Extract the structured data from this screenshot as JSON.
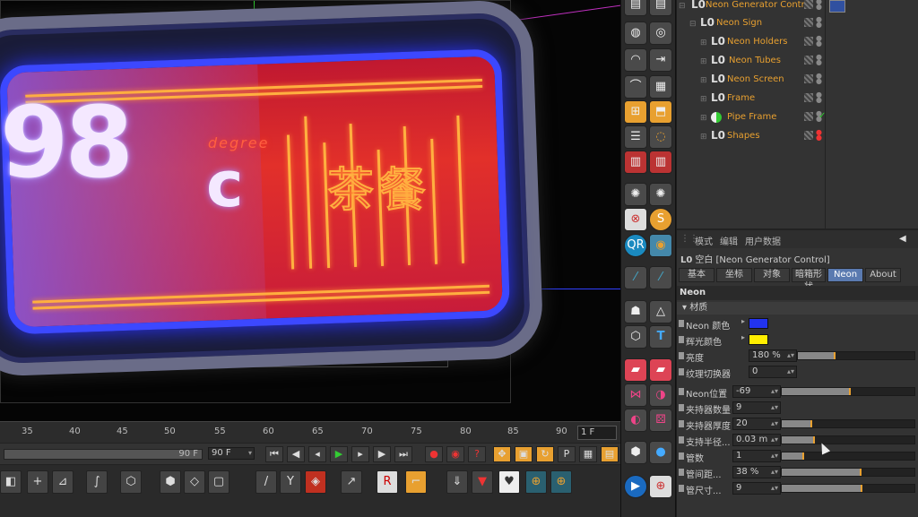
{
  "viewport": {
    "temperature_digits": "98",
    "temperature_unit": "c",
    "degree_text": "degree",
    "chinese_sign_text": "茶餐"
  },
  "timeline": {
    "ticks": [
      "35",
      "40",
      "45",
      "50",
      "55",
      "60",
      "65",
      "70",
      "75",
      "80",
      "85",
      "90"
    ],
    "current_frame": "1 F"
  },
  "transport": {
    "range_value": "90 F",
    "end_frame": "90 F"
  },
  "object_manager": {
    "objects": [
      {
        "label": "Neon Generator Control",
        "indent": 0,
        "selected_green": false
      },
      {
        "label": "Neon Sign",
        "indent": 1
      },
      {
        "label": "Neon Holders",
        "indent": 2
      },
      {
        "label": "Neon Tubes",
        "indent": 2
      },
      {
        "label": "Neon Screen",
        "indent": 2
      },
      {
        "label": "Frame",
        "indent": 2
      },
      {
        "label": "Pipe Frame",
        "indent": 2
      },
      {
        "label": "Shapes",
        "indent": 2
      }
    ]
  },
  "attribute_manager": {
    "menu": [
      "模式",
      "编辑",
      "用户数据"
    ],
    "title": "空白 [Neon Generator Control]",
    "tabs": [
      "基本",
      "坐标",
      "对象",
      "暗箱形状",
      "Neon",
      "About"
    ],
    "active_tab": "Neon",
    "section": "Neon",
    "subsection": "材质",
    "params": [
      {
        "label": "Neon 颜色",
        "type": "color",
        "color": "#2233ee"
      },
      {
        "label": "辉光颜色",
        "type": "color",
        "color": "#ffee00"
      },
      {
        "label": "亮度",
        "type": "slider",
        "value": "180 %",
        "fill": 0.32
      },
      {
        "label": "纹理切换器",
        "type": "field",
        "value": "0"
      },
      {
        "label": "Neon位置",
        "type": "slider",
        "value": "-69",
        "fill": 0.52
      },
      {
        "label": "夹持器数量",
        "type": "field",
        "value": "9"
      },
      {
        "label": "夹持器厚度",
        "type": "slider",
        "value": "20",
        "fill": 0.23
      },
      {
        "label": "支持半径...",
        "type": "slider",
        "value": "0.03 m",
        "fill": 0.25
      },
      {
        "label": "管数",
        "type": "slider",
        "value": "1",
        "fill": 0.17
      },
      {
        "label": "管间距...",
        "type": "slider",
        "value": "38 %",
        "fill": 0.6
      },
      {
        "label": "管尺寸...",
        "type": "slider",
        "value": "9",
        "fill": 0.61
      }
    ]
  }
}
